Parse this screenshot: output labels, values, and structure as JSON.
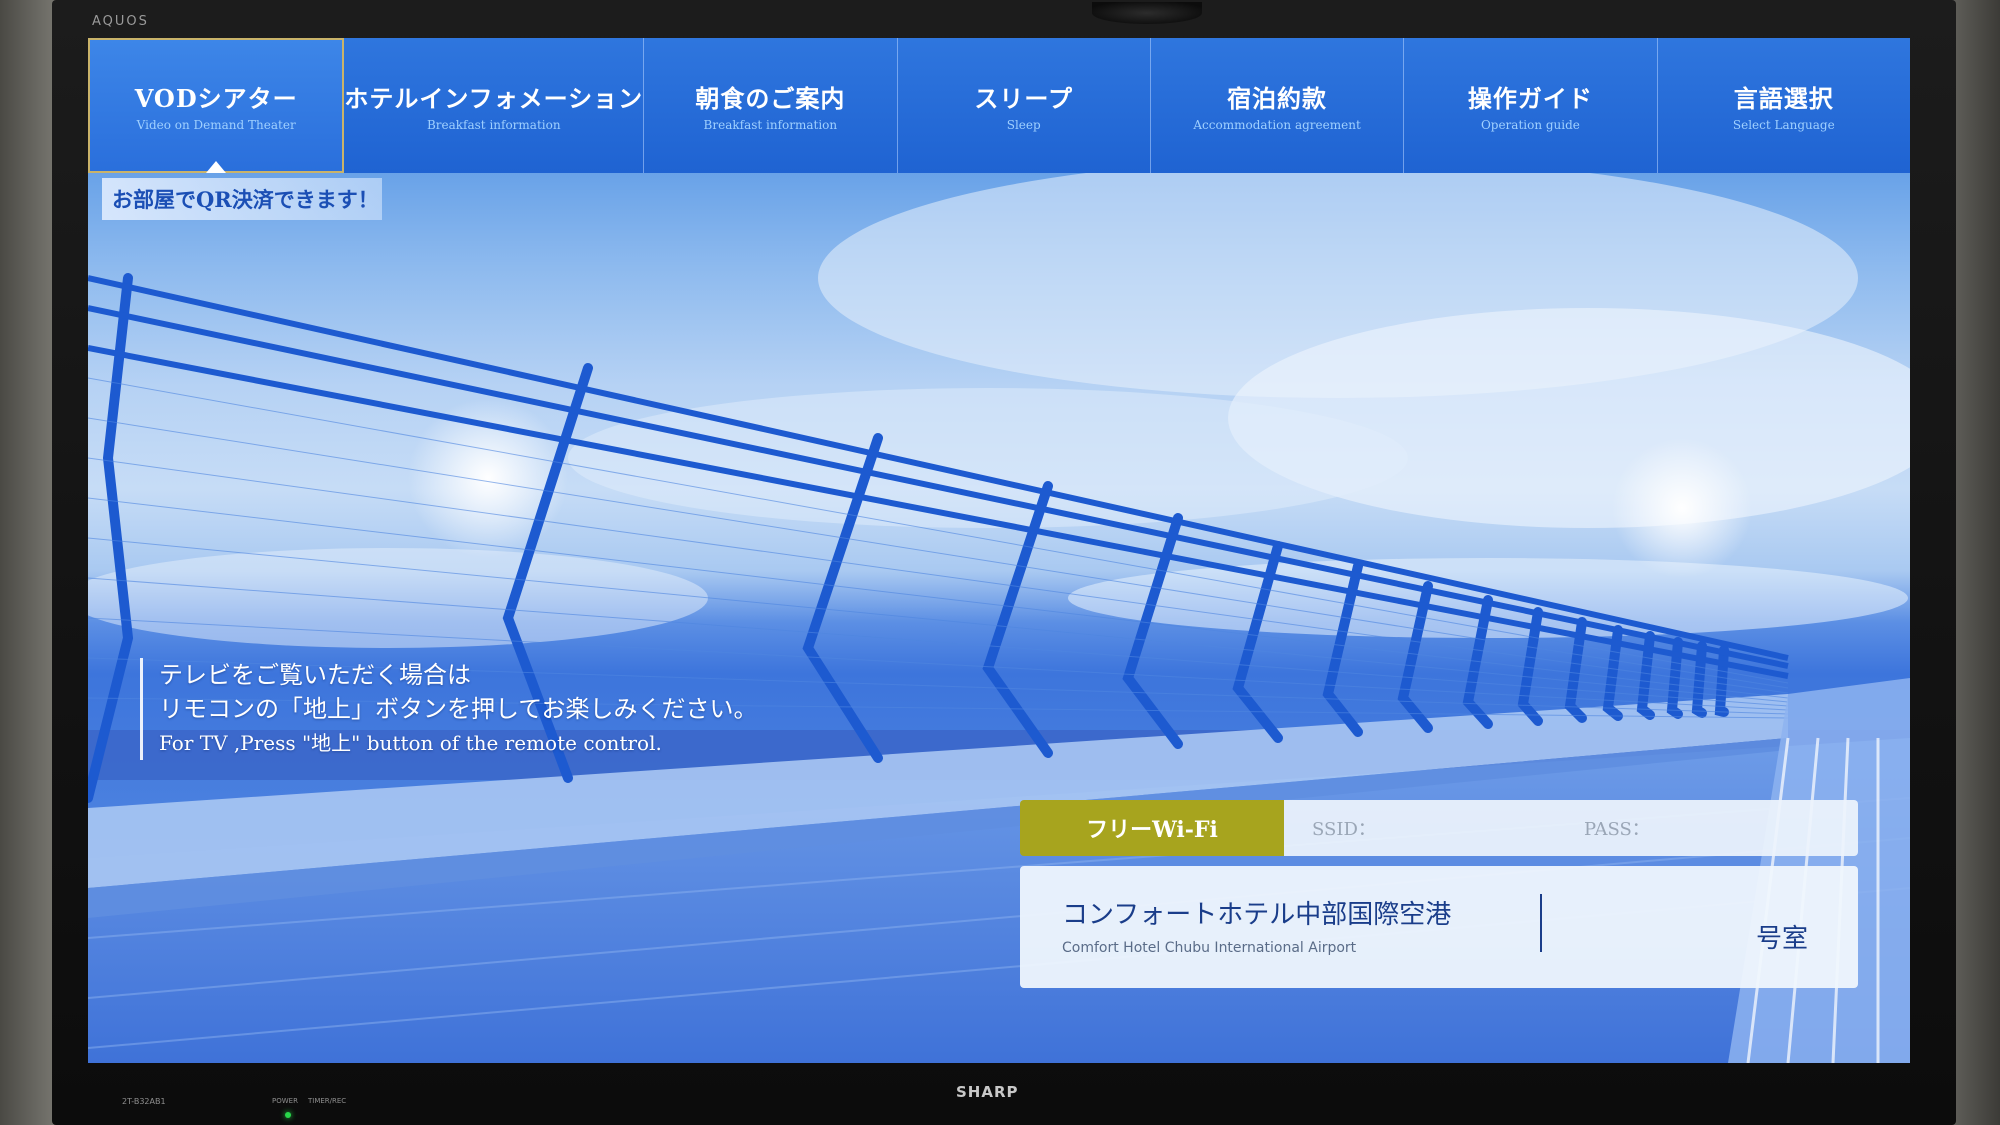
{
  "tv": {
    "brand_top": "AQUOS",
    "brand_bottom": "SHARP",
    "model": "2T-B32AB1",
    "power_label": "POWER",
    "timer_label": "TIMER/REC"
  },
  "menu": {
    "items": [
      {
        "label": "VODシアター",
        "sub": "Video on Demand Theater",
        "active": true
      },
      {
        "label": "ホテルインフォメーション",
        "sub": "Breakfast information"
      },
      {
        "label": "朝食のご案内",
        "sub": "Breakfast information"
      },
      {
        "label": "スリープ",
        "sub": "Sleep"
      },
      {
        "label": "宿泊約款",
        "sub": "Accommodation agreement"
      },
      {
        "label": "操作ガイド",
        "sub": "Operation guide"
      },
      {
        "label": "言語選択",
        "sub": "Select Language"
      }
    ]
  },
  "banner": {
    "qr": "お部屋でQR決済できます！"
  },
  "notice": {
    "line1": "テレビをご覧いただく場合は",
    "line2": "リモコンの「地上」ボタンを押してお楽しみください。",
    "en": "For TV ,Press \"地上\" button of the remote control."
  },
  "wifi": {
    "label": "フリーWi-Fi",
    "ssid_label": "SSID：",
    "pass_label": "PASS："
  },
  "hotel": {
    "name": "コンフォートホテル中部国際空港",
    "name_en": "Comfort Hotel Chubu International Airport",
    "room_suffix": "号室"
  },
  "colors": {
    "menu_blue": "#2a6fdc",
    "active_border": "#c9b36a",
    "wifi_green": "#a7a41e",
    "text_navy": "#1a3d8a"
  }
}
